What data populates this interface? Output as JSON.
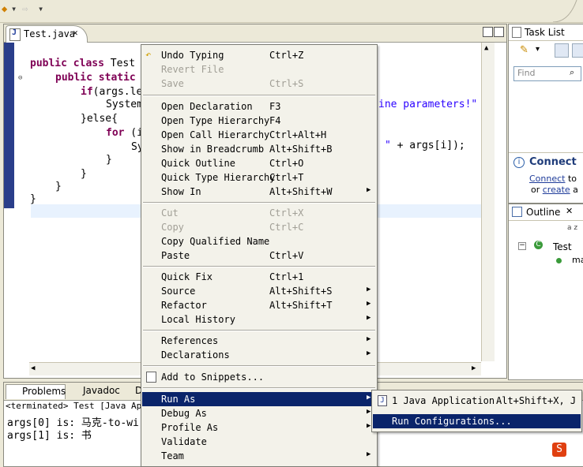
{
  "toolbar": {
    "back_glyph": "◆",
    "dropdown_glyph": "▾",
    "forward_glyph": "⇨"
  },
  "editor": {
    "tab_label": "Test.java",
    "lines": [
      {
        "kw": "public class ",
        "text": "Test"
      },
      {
        "kw": "public static",
        "text": ""
      },
      {
        "kw": "if",
        "text": "(args.le"
      },
      {
        "kw": "",
        "text": "System"
      },
      {
        "kw": "",
        "text": "}else{"
      },
      {
        "kw": "for",
        "text": " (i"
      },
      {
        "kw": "",
        "text": "Sy"
      },
      {
        "kw": "",
        "text": "}"
      },
      {
        "kw": "",
        "text": "}"
      },
      {
        "kw": "",
        "text": "}"
      },
      {
        "kw": "",
        "text": "}"
      }
    ],
    "right_fragments": {
      "line4": "ine parameters!\"",
      "line7": "\" + args[i]);"
    }
  },
  "tasklist": {
    "title": "Task List",
    "find_placeholder": "Find",
    "connect_title": "Connect",
    "connect_link": "Connect",
    "connect_text": " to",
    "or_text": "or ",
    "create_link": "create",
    "create_rest": " a"
  },
  "outline": {
    "title": "Outline",
    "sort_label": "a z",
    "tree_class": "Test",
    "tree_member": "ma"
  },
  "bottom": {
    "tabs": [
      "Problems",
      "Javadoc",
      "D"
    ],
    "status": "<terminated> Test [Java Appli",
    "console_lines": [
      "args[0] is: 马克-to-wi",
      "args[1] is: 书"
    ]
  },
  "context_menu": {
    "items": [
      {
        "label": "Undo Typing",
        "key": "Ctrl+Z",
        "disabled": false
      },
      {
        "label": "Revert File",
        "key": "",
        "disabled": true
      },
      {
        "label": "Save",
        "key": "Ctrl+S",
        "disabled": true
      },
      {
        "label": "Open Declaration",
        "key": "F3"
      },
      {
        "label": "Open Type Hierarchy",
        "key": "F4"
      },
      {
        "label": "Open Call Hierarchy",
        "key": "Ctrl+Alt+H"
      },
      {
        "label": "Show in Breadcrumb",
        "key": "Alt+Shift+B"
      },
      {
        "label": "Quick Outline",
        "key": "Ctrl+O"
      },
      {
        "label": "Quick Type Hierarchy",
        "key": "Ctrl+T"
      },
      {
        "label": "Show In",
        "key": "Alt+Shift+W"
      },
      {
        "label": "Cut",
        "key": "Ctrl+X",
        "disabled": true
      },
      {
        "label": "Copy",
        "key": "Ctrl+C",
        "disabled": true
      },
      {
        "label": "Copy Qualified Name",
        "key": ""
      },
      {
        "label": "Paste",
        "key": "Ctrl+V"
      },
      {
        "label": "Quick Fix",
        "key": "Ctrl+1"
      },
      {
        "label": "Source",
        "key": "Alt+Shift+S"
      },
      {
        "label": "Refactor",
        "key": "Alt+Shift+T"
      },
      {
        "label": "Local History",
        "key": ""
      },
      {
        "label": "References",
        "key": ""
      },
      {
        "label": "Declarations",
        "key": ""
      },
      {
        "label": "Add to Snippets...",
        "key": ""
      },
      {
        "label": "Run As",
        "key": ""
      },
      {
        "label": "Debug As",
        "key": ""
      },
      {
        "label": "Profile As",
        "key": ""
      },
      {
        "label": "Validate",
        "key": ""
      },
      {
        "label": "Team",
        "key": ""
      }
    ],
    "arrow": "▶"
  },
  "submenu": {
    "items": [
      {
        "label": "1 Java Application",
        "key": "Alt+Shift+X, J"
      },
      {
        "label": "Run Configurations...",
        "key": ""
      }
    ]
  },
  "colors": {
    "selection": "#0a246a",
    "keyword": "#7f0055",
    "string": "#2a00ff",
    "ruler": "#2a3e8a"
  }
}
